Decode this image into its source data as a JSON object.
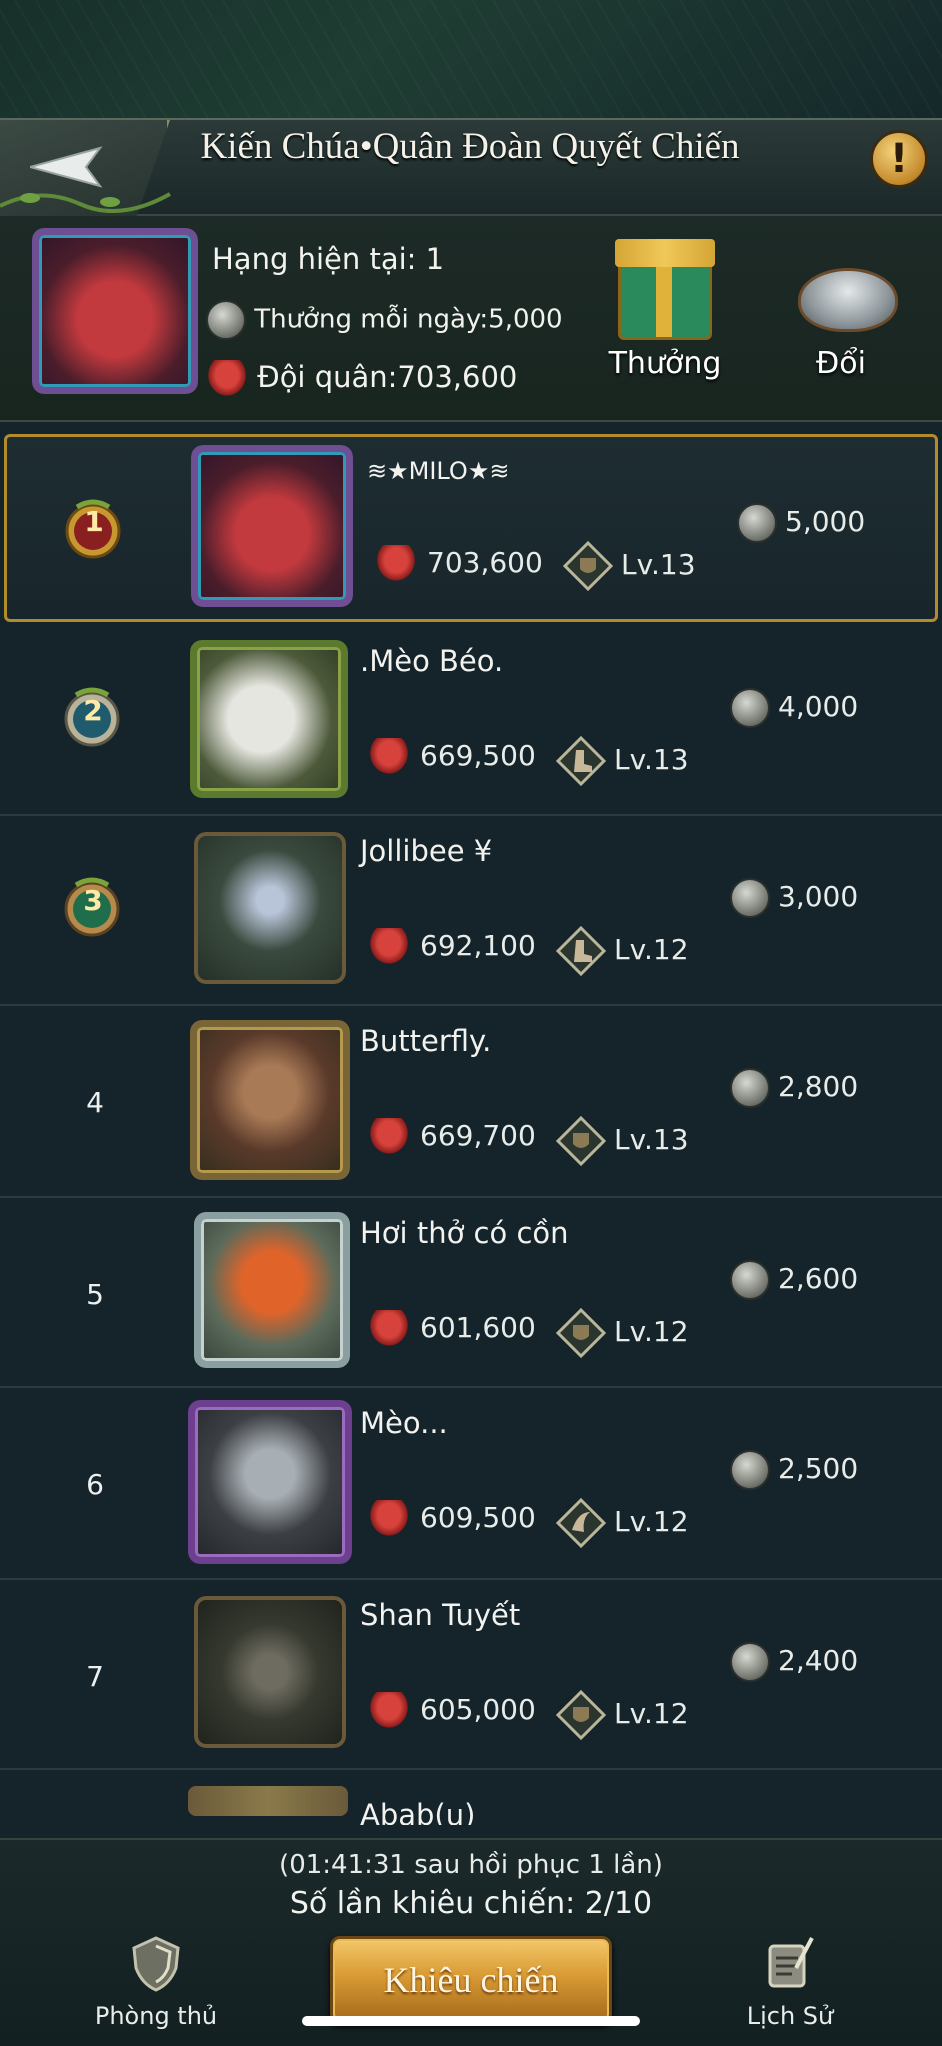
{
  "header": {
    "title": "Kiến Chúa•Quân Đoàn Quyết Chiến"
  },
  "my_rank": {
    "rank_text": "Hạng hiện tại: 1",
    "daily_reward_text": "Thưởng mỗi ngày:5,000",
    "army_text": "Đội quân:703,600",
    "reward_button_label": "Thưởng",
    "exchange_button_label": "Đổi"
  },
  "ranking": [
    {
      "rank": "1",
      "name": "≋★MILO★≋",
      "power": "703,600",
      "level": "Lv.13",
      "reward": "5,000"
    },
    {
      "rank": "2",
      "name": ".Mèo Béo.",
      "power": "669,500",
      "level": "Lv.13",
      "reward": "4,000"
    },
    {
      "rank": "3",
      "name": "Jollibee ¥",
      "power": "692,100",
      "level": "Lv.12",
      "reward": "3,000"
    },
    {
      "rank": "4",
      "name": "Butterfly.",
      "power": "669,700",
      "level": "Lv.13",
      "reward": "2,800"
    },
    {
      "rank": "5",
      "name": "Hơi thở có cồn",
      "power": "601,600",
      "level": "Lv.12",
      "reward": "2,600"
    },
    {
      "rank": "6",
      "name": "Mèo...",
      "power": "609,500",
      "level": "Lv.12",
      "reward": "2,500"
    },
    {
      "rank": "7",
      "name": "Shan Tuyết",
      "power": "605,000",
      "level": "Lv.12",
      "reward": "2,400"
    },
    {
      "rank": "",
      "name": "Abab(u)",
      "power": "",
      "level": "",
      "reward": ""
    }
  ],
  "footer": {
    "recover_text": "(01:41:31 sau hồi phục 1 lần)",
    "attempts_text": "Số lần khiêu chiến: 2/10",
    "defense_label": "Phòng thủ",
    "challenge_label": "Khiêu chiến",
    "history_label": "Lịch Sử"
  },
  "colors": {
    "background": "#15232b",
    "highlight_border": "#b28c2c",
    "button_gold": "#d89a34"
  }
}
